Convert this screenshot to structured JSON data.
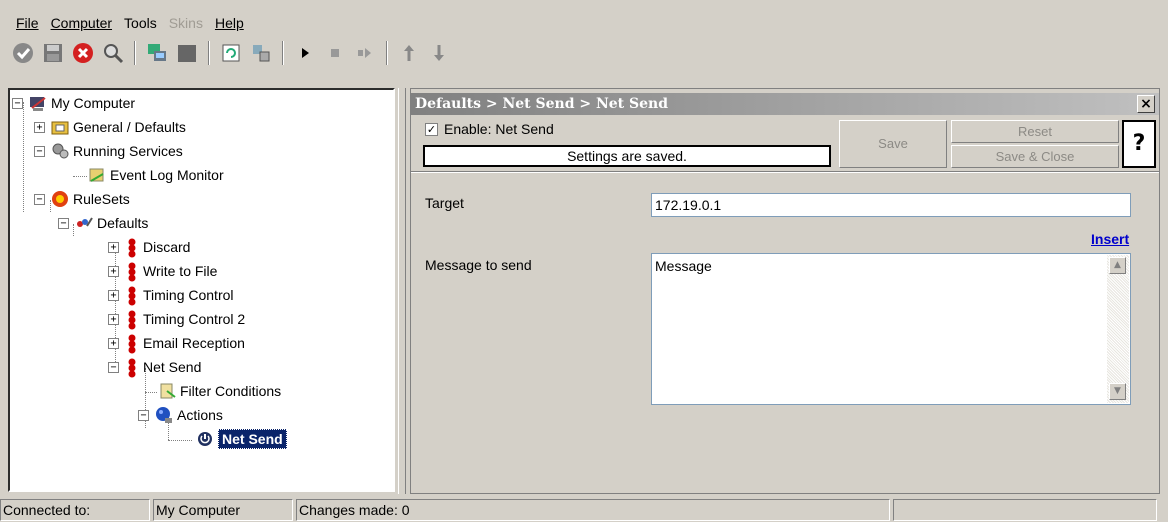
{
  "menu": {
    "items": [
      {
        "label": "File",
        "disabled": false
      },
      {
        "label": "Computer",
        "disabled": false
      },
      {
        "label": "Tools",
        "disabled": false
      },
      {
        "label": "Skins",
        "disabled": true
      },
      {
        "label": "Help",
        "disabled": false
      }
    ]
  },
  "toolbar": {
    "icons": [
      "check-icon",
      "save-icon",
      "stop-red-icon",
      "search-icon",
      "network-icon",
      "block-icon",
      "refresh-icon",
      "config-icon",
      "play-icon",
      "stop-icon",
      "step-icon",
      "arrow-up-icon",
      "arrow-down-icon"
    ]
  },
  "tree": {
    "my_computer": "My Computer",
    "general_defaults": "General / Defaults",
    "running_services": "Running Services",
    "event_log_monitor": "Event Log Monitor",
    "rulesets": "RuleSets",
    "defaults": "Defaults",
    "rules": [
      "Discard",
      "Write to File",
      "Timing Control",
      "Timing Control 2",
      "Email Reception",
      "Net Send"
    ],
    "filter_conditions": "Filter Conditions",
    "actions": "Actions",
    "selected_action": "Net Send"
  },
  "panel": {
    "title": "Defaults > Net Send > Net Send",
    "close": "×",
    "enable_label": "Enable: Net Send",
    "enable_checked": "✓",
    "status": "Settings are saved.",
    "save": "Save",
    "reset": "Reset",
    "save_close": "Save & Close",
    "help": "?",
    "target_label": "Target",
    "target_value": "172.19.0.1",
    "insert": "Insert",
    "message_label": "Message to send",
    "message_value": "Message",
    "scroll_up": "▲",
    "scroll_down": "▼"
  },
  "statusbar": {
    "connected_label": "Connected to:",
    "computer": "My Computer",
    "changes": "Changes made: 0",
    "extra": ""
  },
  "colors": {
    "window_bg": "#d4d0c8",
    "selection_bg": "#0a246a",
    "link": "#0000cc",
    "rule_icon": "#cc0000"
  }
}
